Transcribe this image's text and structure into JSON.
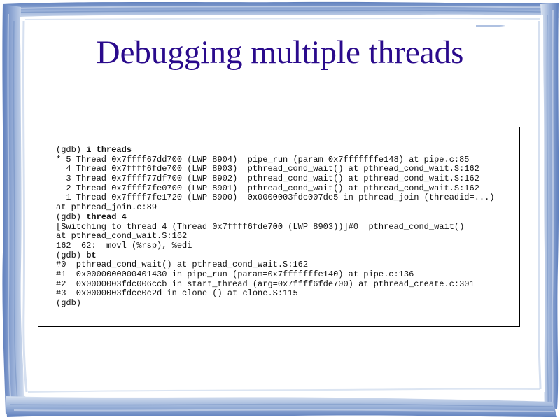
{
  "slide": {
    "title": "Debugging multiple threads"
  },
  "terminal": {
    "lines": [
      {
        "plain": "(gdb) ",
        "bold": "i threads"
      },
      {
        "plain": "* 5 Thread 0x7ffff67dd700 (LWP 8904)  pipe_run (param=0x7fffffffe148) at pipe.c:85"
      },
      {
        "plain": "  4 Thread 0x7ffff6fde700 (LWP 8903)  pthread_cond_wait() at pthread_cond_wait.S:162"
      },
      {
        "plain": "  3 Thread 0x7ffff77df700 (LWP 8902)  pthread_cond_wait() at pthread_cond_wait.S:162"
      },
      {
        "plain": "  2 Thread 0x7ffff7fe0700 (LWP 8901)  pthread_cond_wait() at pthread_cond_wait.S:162"
      },
      {
        "plain": "  1 Thread 0x7ffff7fe1720 (LWP 8900)  0x0000003fdc007de5 in pthread_join (threadid=...)"
      },
      {
        "plain": "at pthread_join.c:89"
      },
      {
        "plain": "(gdb) ",
        "bold": "thread 4"
      },
      {
        "plain": "[Switching to thread 4 (Thread 0x7ffff6fde700 (LWP 8903))]#0  pthread_cond_wait()"
      },
      {
        "plain": "at pthread_cond_wait.S:162"
      },
      {
        "plain": "162  62:  movl (%rsp), %edi"
      },
      {
        "plain": "(gdb) ",
        "bold": "bt"
      },
      {
        "plain": "#0  pthread_cond_wait() at pthread_cond_wait.S:162"
      },
      {
        "plain": "#1  0x0000000000401430 in pipe_run (param=0x7fffffffe140) at pipe.c:136"
      },
      {
        "plain": "#2  0x0000003fdc006ccb in start_thread (arg=0x7ffff6fde700) at pthread_create.c:301"
      },
      {
        "plain": "#3  0x0000003fdce0c2d in clone () at clone.S:115"
      },
      {
        "plain": "(gdb)"
      }
    ]
  },
  "theme": {
    "title_color": "#2a0a8c",
    "frame_color": "#7f9ccc",
    "frame_dark": "#5a7ab8",
    "frame_light": "#c5d3ea"
  }
}
